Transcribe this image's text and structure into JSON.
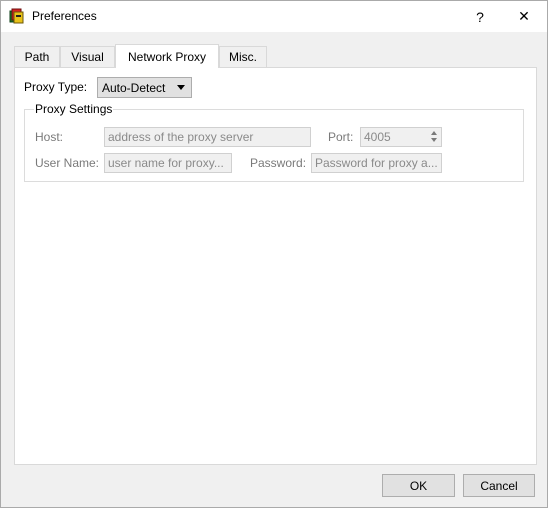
{
  "window": {
    "title": "Preferences"
  },
  "titlebar": {
    "help_label": "?",
    "close_label": "✕"
  },
  "tabs": [
    {
      "label": "Path"
    },
    {
      "label": "Visual"
    },
    {
      "label": "Network Proxy"
    },
    {
      "label": "Misc."
    }
  ],
  "proxy": {
    "type_label": "Proxy Type:",
    "type_value": "Auto-Detect",
    "settings_title": "Proxy Settings",
    "host_label": "Host:",
    "host_placeholder": "address of the proxy server",
    "port_label": "Port:",
    "port_value": "4005",
    "username_label": "User Name:",
    "username_placeholder": "user name for proxy...",
    "password_label": "Password:",
    "password_placeholder": "Password for proxy a..."
  },
  "buttons": {
    "ok_label": "OK",
    "cancel_label": "Cancel"
  },
  "icons": {
    "app": "preferences-app-icon",
    "dropdown": "chevron-down-icon",
    "spinner": "spinner-arrows-icon"
  },
  "colors": {
    "panel_bg": "#ffffff",
    "window_bg": "#f0f0f0",
    "disabled_text": "#7a7a7a"
  }
}
